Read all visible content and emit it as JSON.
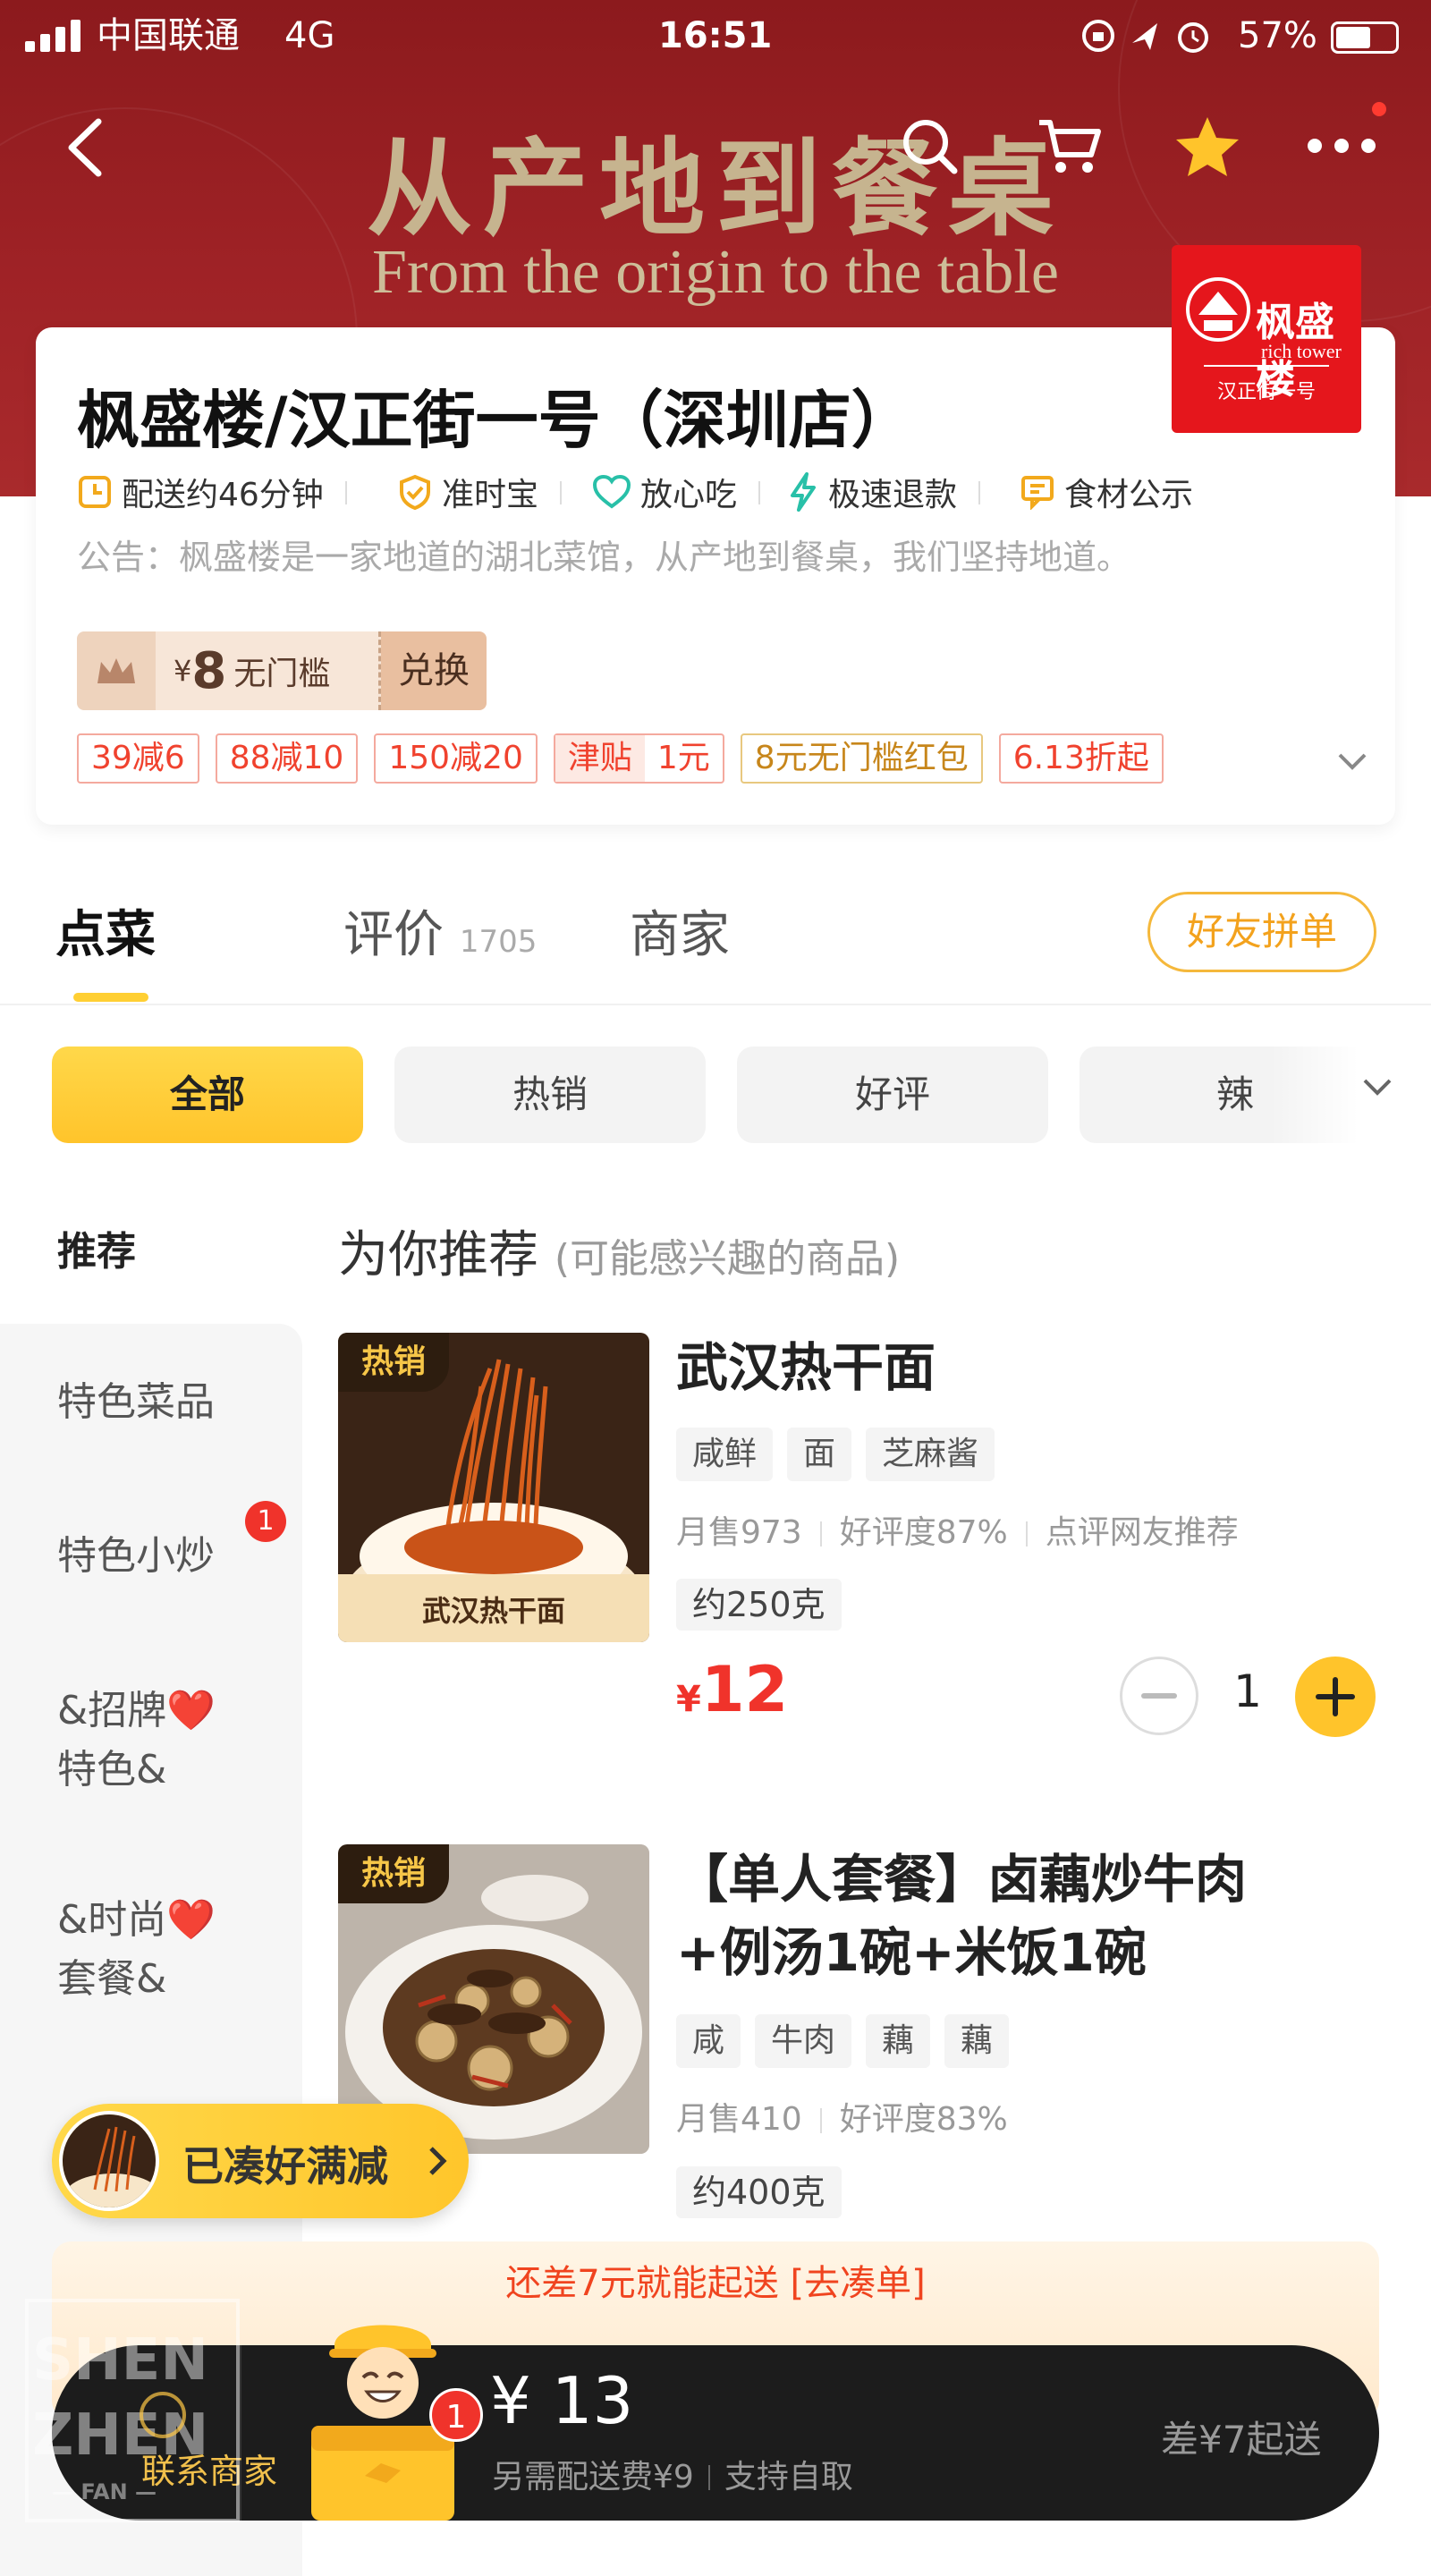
{
  "status_bar": {
    "carrier": "中国联通",
    "network": "4G",
    "time": "16:51",
    "battery": "57%"
  },
  "banner": {
    "title": "从产地到餐桌",
    "subtitle": "From the origin to the table"
  },
  "nav": {
    "back_icon": "chevron-left-icon",
    "search_icon": "search-icon",
    "cart_icon": "cart-icon",
    "favorite_icon": "star-icon",
    "more_icon": "more-icon"
  },
  "store": {
    "name": "枫盛楼/汉正街一号（深圳店）",
    "logo_text": "枫盛楼",
    "logo_en": "rich tower",
    "logo_sub": "汉正街一号",
    "features": [
      {
        "icon": "clock-icon",
        "label": "配送约46分钟"
      },
      {
        "icon": "shield-icon",
        "label": "准时宝"
      },
      {
        "icon": "heart-icon",
        "label": "放心吃"
      },
      {
        "icon": "lightning-icon",
        "label": "极速退款"
      },
      {
        "icon": "notice-icon",
        "label": "食材公示"
      }
    ],
    "notice": "公告：枫盛楼是一家地道的湖北菜馆，从产地到餐桌，我们坚持地道。"
  },
  "coupon": {
    "currency": "¥",
    "amount": "8",
    "condition": "无门槛",
    "action": "兑换"
  },
  "promos": [
    {
      "label": "39减6",
      "style": "red"
    },
    {
      "label": "88减10",
      "style": "red"
    },
    {
      "label": "150减20",
      "style": "red"
    },
    {
      "label": "津贴",
      "extra": "1元",
      "style": "red"
    },
    {
      "label": "8元无门槛红包",
      "style": "gold"
    },
    {
      "label": "6.13折起",
      "style": "red"
    }
  ],
  "tabs": [
    {
      "label": "点菜",
      "active": true
    },
    {
      "label": "评价",
      "count": "1705"
    },
    {
      "label": "商家"
    }
  ],
  "friends_order_label": "好友拼单",
  "filters": [
    "全部",
    "热销",
    "好评",
    "辣"
  ],
  "sidebar": {
    "active": "推荐",
    "items": [
      {
        "label": "特色菜品"
      },
      {
        "label": "特色小炒",
        "badge": "1"
      },
      {
        "label": "&招牌❤️\n特色&"
      },
      {
        "label": "&时尚❤️\n套餐&"
      }
    ]
  },
  "section": {
    "title": "为你推荐",
    "subtitle": "(可能感兴趣的商品)"
  },
  "products": [
    {
      "badge": "热销",
      "image_caption": "武汉热干面",
      "name": "武汉热干面",
      "tags": [
        "咸鲜",
        "面",
        "芝麻酱"
      ],
      "monthly_sales": "月售973",
      "rating": "好评度87%",
      "recommend": "点评网友推荐",
      "weight": "约250克",
      "currency": "¥",
      "price": "12",
      "quantity": "1"
    },
    {
      "badge": "热销",
      "name_line1": "【单人套餐】卤藕炒牛肉",
      "name_line2": "+例汤1碗+米饭1碗",
      "tags": [
        "咸",
        "牛肉",
        "藕",
        "藕"
      ],
      "monthly_sales": "月售410",
      "rating": "好评度83%",
      "weight": "约400克"
    }
  ],
  "deal_pill": {
    "label": "已凑好满减"
  },
  "min_order": {
    "message": "还差7元就能起送 [去凑单]"
  },
  "cart": {
    "count": "1",
    "total": "¥ 13",
    "delivery_fee": "另需配送费¥9",
    "pickup": "支持自取",
    "need_more": "差¥7起送",
    "contact": "联系商家"
  },
  "colors": {
    "banner_red": "#9f2226",
    "accent_yellow": "#ffc42b",
    "price_red": "#f0332b"
  }
}
